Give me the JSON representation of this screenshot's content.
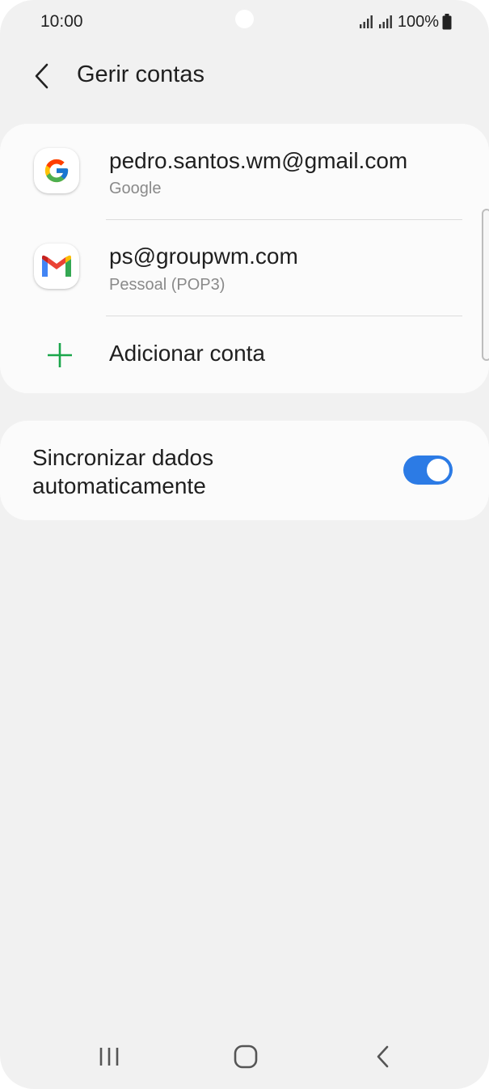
{
  "status_bar": {
    "time": "10:00",
    "battery": "100%",
    "icons": [
      "signal-icon",
      "signal-icon",
      "battery-icon"
    ]
  },
  "header": {
    "title": "Gerir contas",
    "back_icon": "chevron-left-icon"
  },
  "accounts": [
    {
      "name": "pedro.santos.wm@gmail.com",
      "type": "Google",
      "icon": "google-icon"
    },
    {
      "name": "ps@groupwm.com",
      "type": "Pessoal (POP3)",
      "icon": "gmail-icon"
    }
  ],
  "add_account": {
    "label": "Adicionar conta",
    "icon": "plus-icon",
    "icon_color": "#1aa64b"
  },
  "sync": {
    "label_line1": "Sincronizar dados",
    "label_line2": "automaticamente",
    "enabled": true,
    "toggle_color": "#2c7be5"
  },
  "nav_bar": {
    "icons": [
      "recent-apps-icon",
      "home-icon",
      "back-icon"
    ]
  }
}
